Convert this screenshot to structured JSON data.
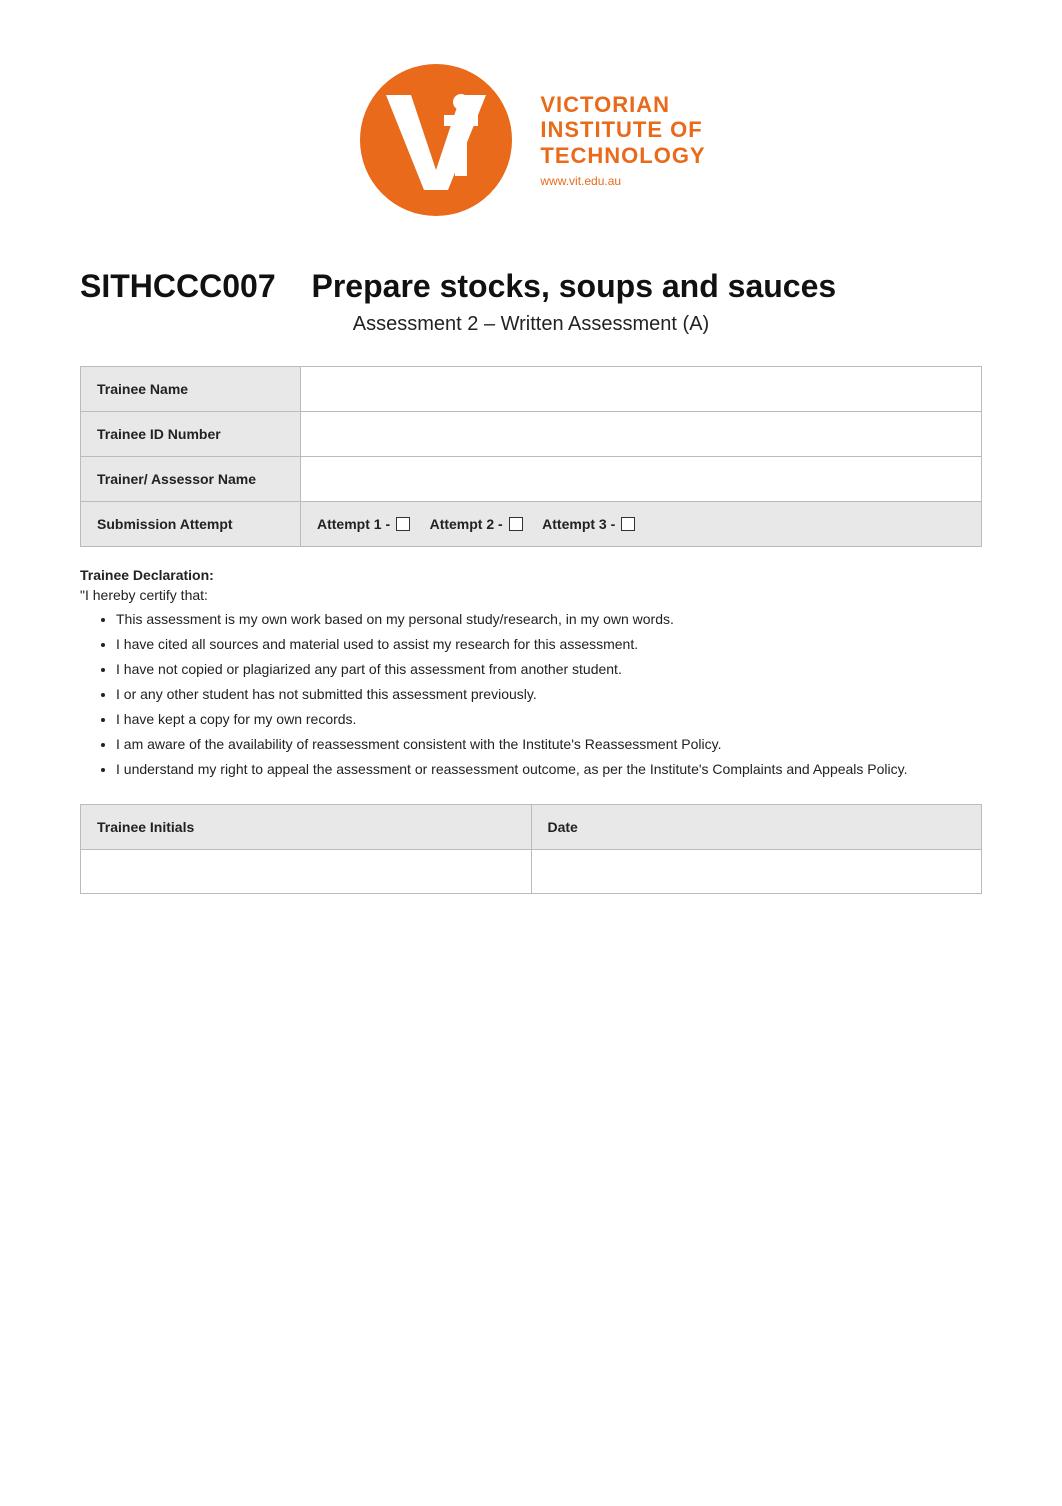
{
  "logo": {
    "org_line1": "VICTORIAN",
    "org_line2": "INSTITUTE OF",
    "org_line3": "TECHNOLOGY",
    "org_url": "www.vit.edu.au"
  },
  "header": {
    "course_code": "SITHCCC007",
    "course_title": "Prepare stocks, soups and sauces",
    "assessment_subtitle": "Assessment 2 – Written Assessment (A)"
  },
  "form": {
    "trainee_name_label": "Trainee Name",
    "trainee_id_label": "Trainee ID Number",
    "trainer_label": "Trainer/ Assessor Name",
    "submission_label": "Submission Attempt",
    "attempt1_label": "Attempt 1 -",
    "attempt2_label": "Attempt 2 -",
    "attempt3_label": "Attempt 3 -"
  },
  "declaration": {
    "title": "Trainee Declaration:",
    "intro": "\"I hereby certify that:",
    "items": [
      "This assessment is my own work based on my personal study/research, in my own words.",
      "I have cited all sources and material used to assist my research for this assessment.",
      "I have not copied or plagiarized any part of this assessment from another student.",
      "I or any other student has not submitted this assessment previously.",
      "I have kept a copy for my own records.",
      "I am aware of the availability of reassessment consistent with the Institute's Reassessment Policy.",
      "I understand my right to appeal the assessment or reassessment outcome, as per the Institute's Complaints and Appeals Policy."
    ]
  },
  "signature": {
    "initials_label": "Trainee Initials",
    "date_label": "Date"
  }
}
